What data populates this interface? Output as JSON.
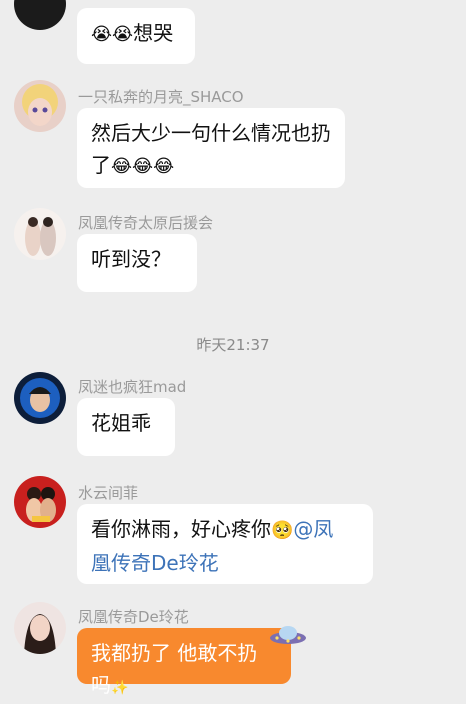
{
  "timestamp": "昨天21:37",
  "messages": [
    {
      "id": "m1",
      "name": "",
      "text": "想哭",
      "emoji": "😭😭"
    },
    {
      "id": "m2",
      "name": "一只私奔的月亮_SHACO",
      "line1": "然后大少一句什么情况也扔",
      "line2": "了",
      "emoji": "😂😂😂"
    },
    {
      "id": "m3",
      "name": "凤凰传奇太原后援会",
      "text": "听到没？"
    },
    {
      "id": "m4",
      "name": "凤迷也疯狂mad",
      "text": "花姐乖"
    },
    {
      "id": "m5",
      "name": "水云间菲",
      "line1": "看你淋雨，好心疼你",
      "emoji": "🥺",
      "mention1": "@凤",
      "mention2": "凰传奇De玲花"
    },
    {
      "id": "m6",
      "name": "凤凰传奇De玲花",
      "text": "我都扔了 他敢不扔吗",
      "sparkle": "✨"
    }
  ],
  "colors": {
    "background": "#ededed",
    "bubble": "#ffffff",
    "bubble_orange": "#f8892e",
    "mention": "#3d73b8",
    "name": "#9a9a9a"
  }
}
